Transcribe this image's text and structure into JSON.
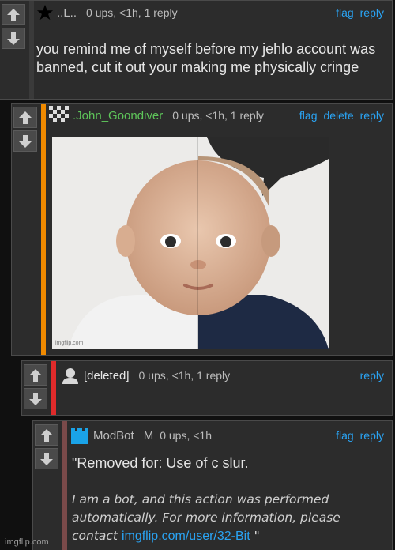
{
  "comments": [
    {
      "username": "..L..",
      "meta": "0 ups, <1h, 1 reply",
      "actions": [
        "flag",
        "reply"
      ],
      "body": "you remind me of myself before my jehlo account was banned, cut it out your making me physically cringe"
    },
    {
      "username": ".John_Goondiver",
      "meta": "0 ups, <1h, 1 reply",
      "actions": [
        "flag",
        "delete",
        "reply"
      ],
      "image_watermark": "imgflip.com",
      "accent_color": "#f08a00",
      "username_color": "#5ec55a"
    },
    {
      "username": "[deleted]",
      "meta": "0 ups, <1h, 1 reply",
      "actions": [
        "reply"
      ],
      "accent_color": "#e02b2b"
    },
    {
      "username": "ModBot",
      "badge": "M",
      "meta": "0 ups, <1h",
      "actions": [
        "flag",
        "reply"
      ],
      "body_line": "\"Removed for: Use of c slur.",
      "bot_note": "I am a bot, and this action was performed automatically. For more information, please contact",
      "contact_link": "imgflip.com/user/32-Bit",
      "closing_quote": "\"",
      "accent_color": "#7a4a4a"
    }
  ],
  "footer": {
    "watermark": "imgflip.com"
  }
}
